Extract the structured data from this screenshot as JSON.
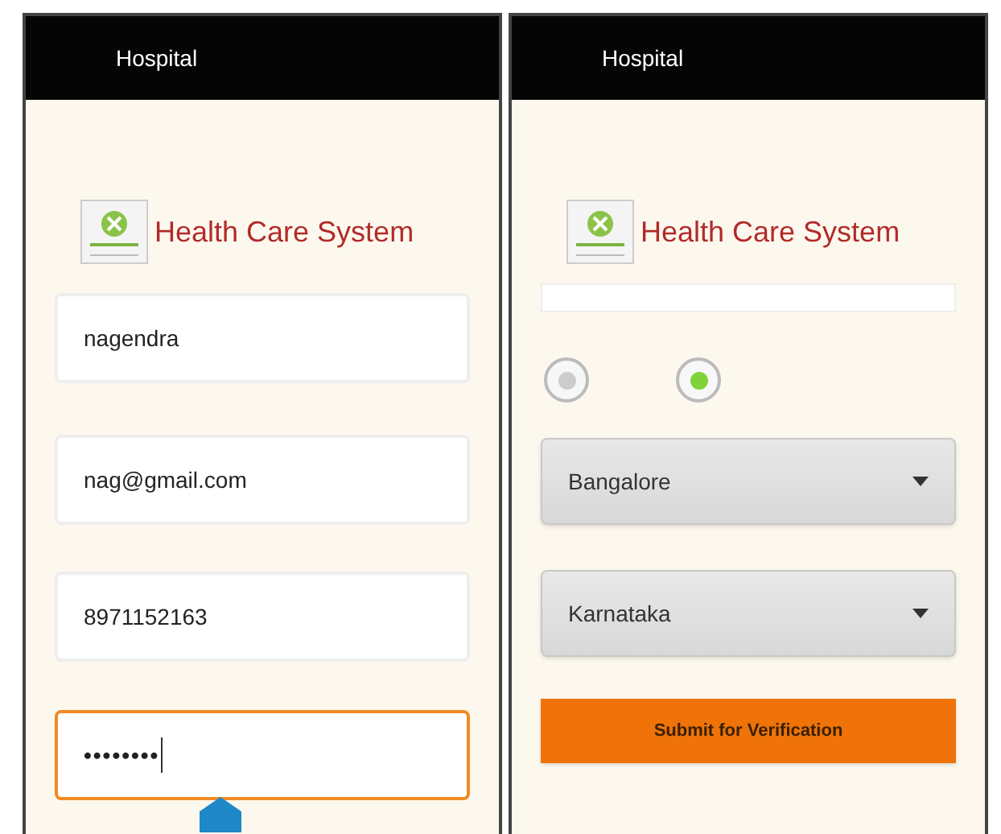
{
  "screens": [
    {
      "title": "Hospital",
      "app_name": "Health Care System",
      "fields": [
        {
          "kind": "text",
          "value": "nagendra",
          "focused": false
        },
        {
          "kind": "text",
          "value": "nag@gmail.com",
          "focused": false
        },
        {
          "kind": "text",
          "value": "8971152163",
          "focused": false
        },
        {
          "kind": "password",
          "value": "••••••••",
          "focused": true
        }
      ]
    },
    {
      "title": "Hospital",
      "app_name": "Health Care System",
      "fields": [
        {
          "kind": "partial"
        },
        {
          "kind": "radio",
          "options": [
            {
              "selected": false
            },
            {
              "selected": true
            }
          ]
        },
        {
          "kind": "dropdown",
          "value": "Bangalore"
        },
        {
          "kind": "dropdown",
          "value": "Karnataka"
        },
        {
          "kind": "button",
          "label": "Submit for Verification"
        }
      ]
    }
  ]
}
